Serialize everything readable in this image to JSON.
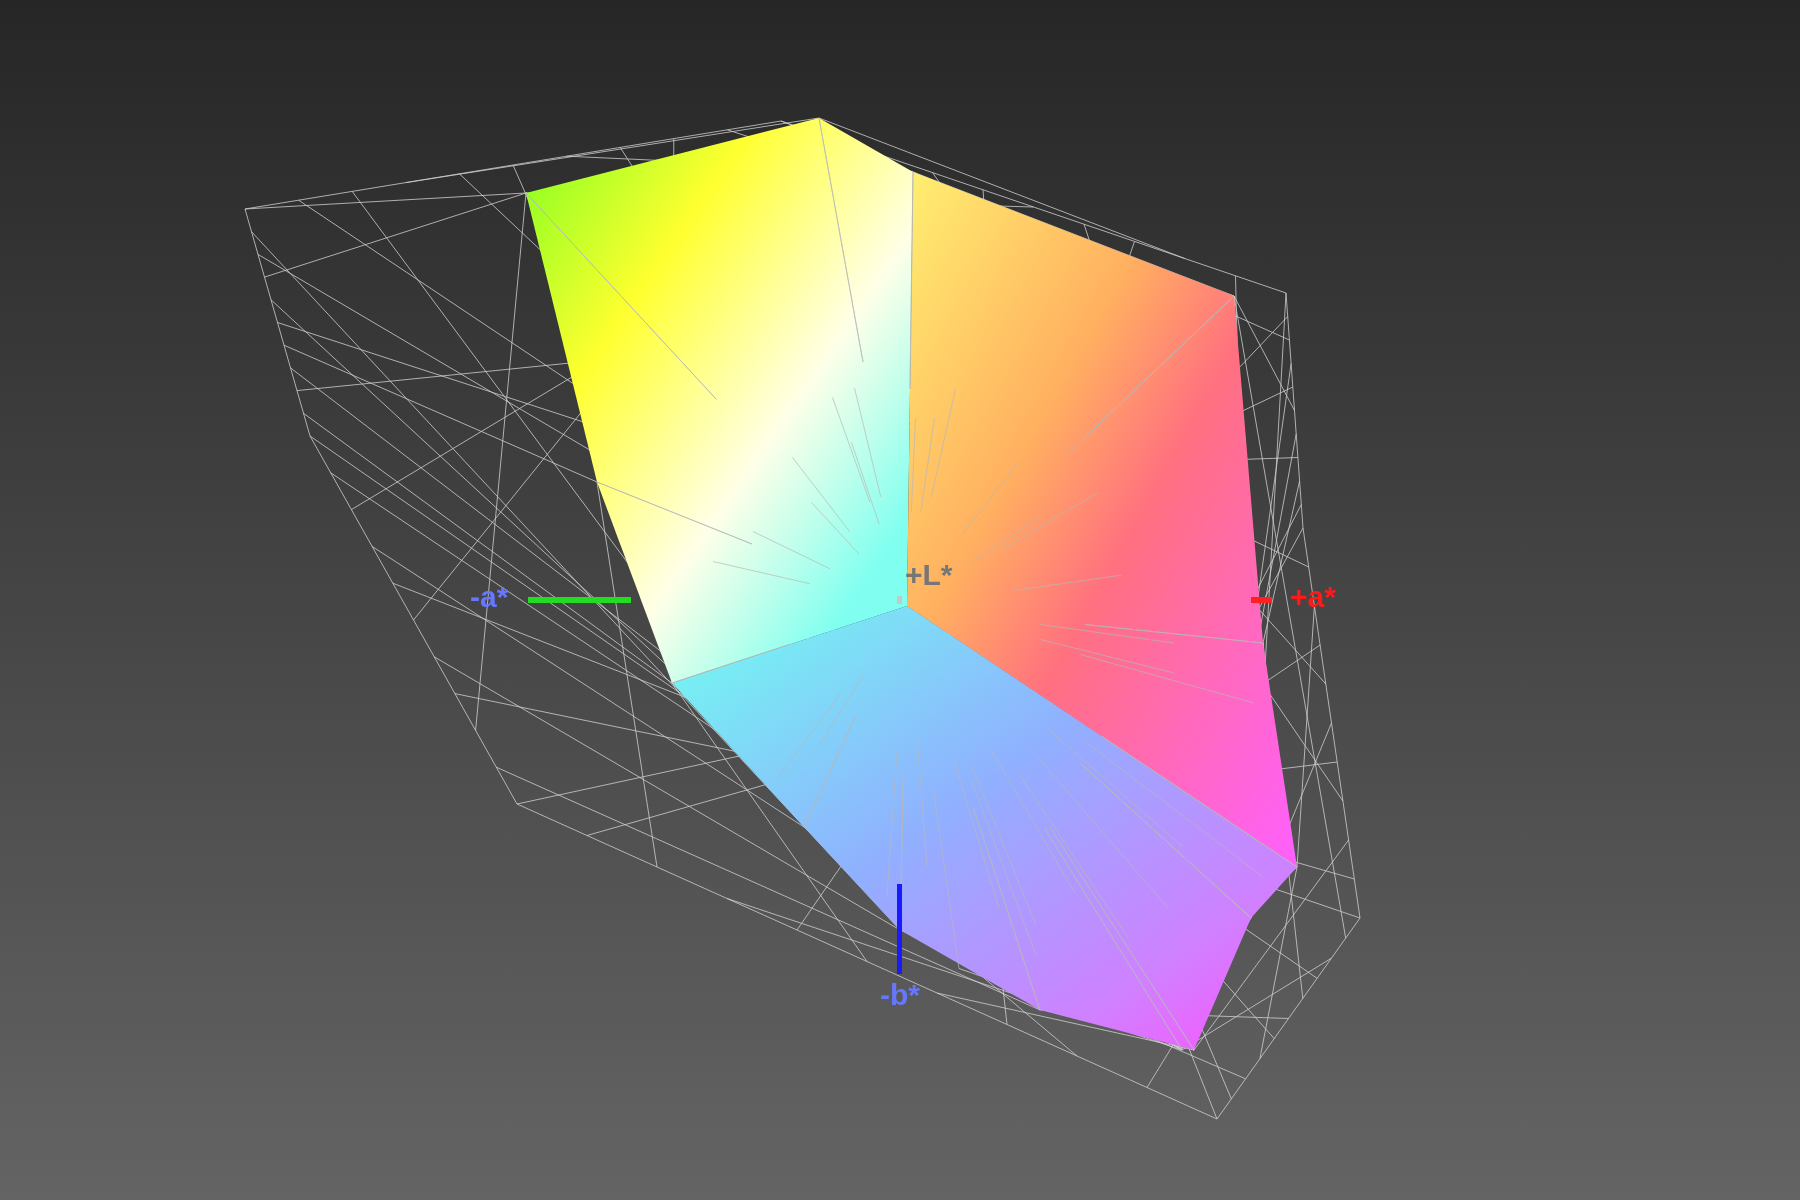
{
  "viewport": {
    "axes": [
      {
        "kind": "minus-a",
        "label": "-a*",
        "color": "#6677ff"
      },
      {
        "kind": "plus-a",
        "label": "+a*",
        "color": "#ff1a1a"
      },
      {
        "kind": "plus-l",
        "label": "+L*",
        "color": "#767676"
      },
      {
        "kind": "minus-b",
        "label": "-b*",
        "color": "#6677ff"
      }
    ]
  }
}
